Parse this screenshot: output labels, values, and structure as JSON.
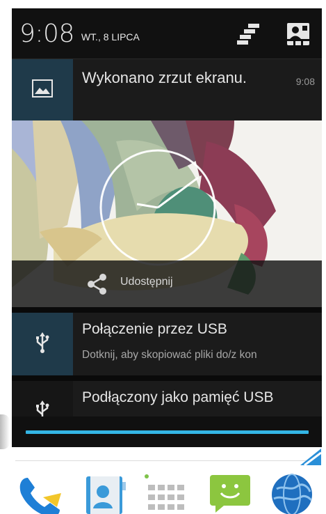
{
  "status_header": {
    "time": "9:08",
    "date": "WT., 8 LIPCA",
    "settings_icon": "notification-settings-icon",
    "quick_settings_icon": "quick-settings-icon"
  },
  "notifications": {
    "screenshot": {
      "icon": "image-icon",
      "title": "Wykonano zrzut ekranu.",
      "time": "9:08",
      "share_label": "Udostępnij",
      "share_icon": "share-icon"
    },
    "usb_connection": {
      "icon": "usb-icon",
      "title": "Połączenie przez USB",
      "text": "Dotknij, aby skopiować pliki do/z kon"
    },
    "usb_storage": {
      "icon": "usb-icon",
      "title": "Podłączony jako pamięć USB"
    }
  },
  "colors": {
    "accent": "#33b5e5",
    "tile": "#1f3a4a",
    "shade_bg": "#0a0a0a"
  },
  "dock": {
    "icons": [
      "phone-icon",
      "contacts-icon",
      "app-drawer-icon",
      "messaging-icon",
      "browser-icon"
    ]
  }
}
